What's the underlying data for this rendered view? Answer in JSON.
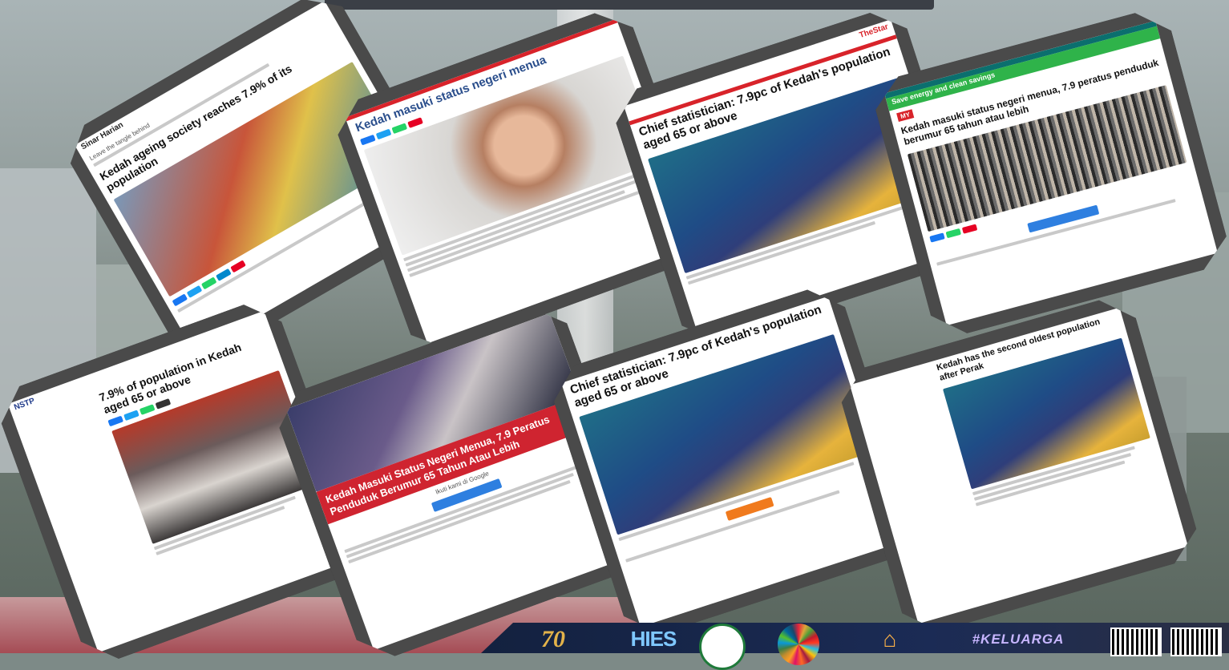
{
  "cards": [
    {
      "id": "card1",
      "masthead": "Sinar Harian",
      "headline": "Kedah ageing society reaches 7.9% of its population",
      "subtitle": "Leave the tangle behind"
    },
    {
      "id": "card2",
      "headline": "Kedah masuki status negeri menua"
    },
    {
      "id": "card3",
      "masthead": "TheStar",
      "headline": "Chief statistician: 7.9pc of Kedah's population aged 65 or above"
    },
    {
      "id": "card4",
      "banner": "Save energy and clean savings",
      "label": "MY",
      "headline": "Kedah masuki status negeri menua, 7.9 peratus penduduk berumur 65 tahun atau lebih"
    },
    {
      "id": "card5",
      "masthead": "NSTP",
      "headline": "7.9% of population in Kedah aged 65 or above"
    },
    {
      "id": "card6",
      "headline": "Kedah Masuki Status Negeri Menua, 7.9 Peratus Penduduk Berumur 65 Tahun Atau Lebih",
      "button": "Ikuti kami di Google"
    },
    {
      "id": "card7",
      "headline": "Chief statistician: 7.9pc of Kedah's population aged 65 or above"
    },
    {
      "id": "card8",
      "headline": "Kedah has the second oldest population after Perak"
    }
  ],
  "footer": {
    "anniversary": "70",
    "survey_logo": "HIES",
    "hashtag": "#KELUARGA"
  },
  "colors": {
    "frame": "#4a4a4a",
    "accent_red": "#d8232a",
    "footer_navy": "#13213f"
  }
}
